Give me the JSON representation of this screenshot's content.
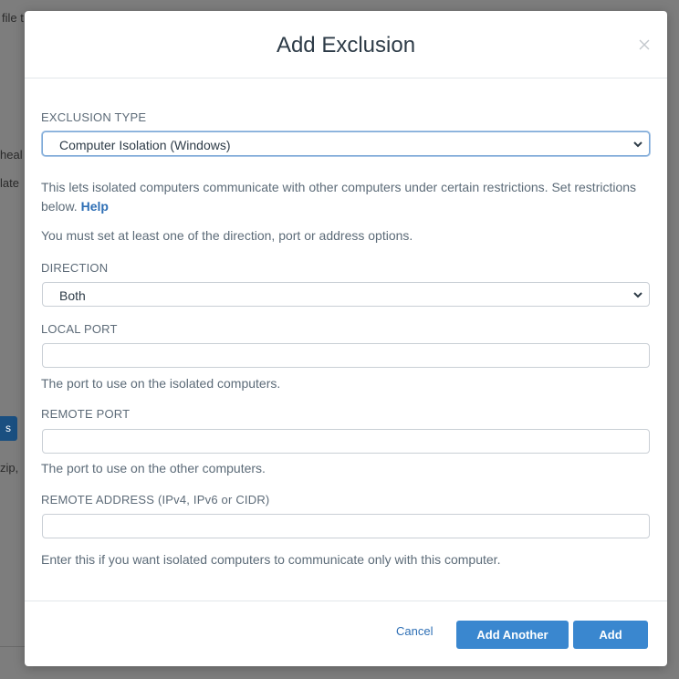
{
  "background": {
    "fragments": [
      "file t",
      "heal",
      "late",
      "zip,"
    ],
    "button_label": "s"
  },
  "modal": {
    "title": "Add Exclusion",
    "close_icon": "close-icon"
  },
  "form": {
    "exclusion_type": {
      "label": "EXCLUSION TYPE",
      "value": "Computer Isolation (Windows)"
    },
    "description": {
      "text": "This lets isolated computers communicate with other computers under certain restrictions. Set restrictions below.",
      "help_link": "Help"
    },
    "requirement_note": "You must set at least one of the direction, port or address options.",
    "direction": {
      "label": "DIRECTION",
      "value": "Both"
    },
    "local_port": {
      "label": "LOCAL PORT",
      "value": "",
      "hint": "The port to use on the isolated computers."
    },
    "remote_port": {
      "label": "REMOTE PORT",
      "value": "",
      "hint": "The port to use on the other computers."
    },
    "remote_address": {
      "label": "REMOTE ADDRESS (IPv4, IPv6 or CIDR)",
      "value": "",
      "hint": "Enter this if you want isolated computers to communicate only with this computer."
    }
  },
  "footer": {
    "cancel_label": "Cancel",
    "add_another_label": "Add Another",
    "add_label": "Add"
  },
  "colors": {
    "accent": "#3a87cf",
    "link": "#2e6fb5",
    "overlay": "#7d7d7d"
  }
}
